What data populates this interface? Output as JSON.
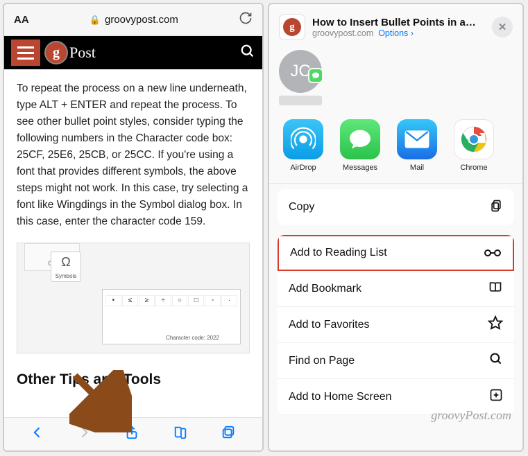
{
  "left": {
    "url_bar": {
      "aa": "AA",
      "domain": "groovypost.com"
    },
    "logo_text": "Post",
    "article_text": "To repeat the process on a new line underneath, type ALT + ENTER and repeat the process. To see other bullet point styles, consider typing the following numbers in the Character code box: 25CF, 25E6, 25CB, or 25CC. If you're using a font that provides different symbols, the above steps might not work. In this case, try selecting a font like Wingdings in the Symbol dialog box. In this case, enter the character code 159.",
    "ribbon_label": "Co",
    "symbol_label": "Symbols",
    "char_code_label": "Character code:",
    "char_code_value": "2022",
    "chars": [
      "•",
      "≤",
      "≥",
      "÷",
      "○",
      "□",
      "◦",
      "·"
    ],
    "heading": "Other Tips and Tools"
  },
  "right": {
    "title": "How to Insert Bullet Points in a…",
    "domain": "groovypost.com",
    "options": "Options",
    "avatar_initials": "JC",
    "apps": [
      {
        "key": "airdrop",
        "label": "AirDrop"
      },
      {
        "key": "messages",
        "label": "Messages"
      },
      {
        "key": "mail",
        "label": "Mail"
      },
      {
        "key": "chrome",
        "label": "Chrome"
      }
    ],
    "actions": {
      "copy": "Copy",
      "reading": "Add to Reading List",
      "bookmark": "Add Bookmark",
      "favorites": "Add to Favorites",
      "find": "Find on Page",
      "home": "Add to Home Screen"
    }
  },
  "watermark": "groovyPost.com"
}
